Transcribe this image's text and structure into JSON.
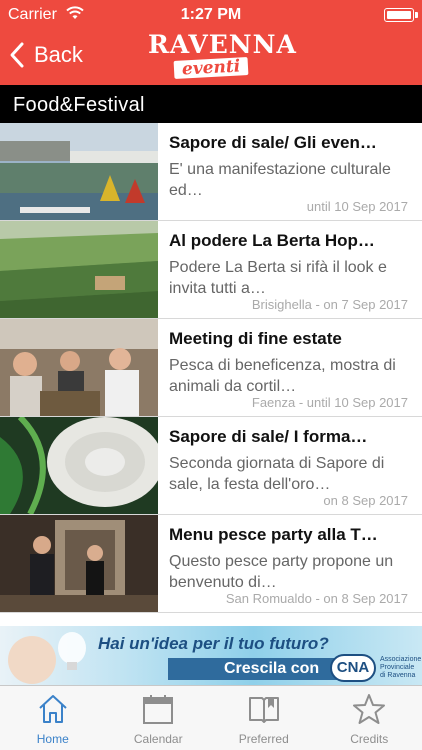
{
  "status_bar": {
    "carrier": "Carrier",
    "time": "1:27 PM"
  },
  "nav": {
    "back_label": "Back",
    "logo_line1": "RAVENNA",
    "logo_line2": "eventi"
  },
  "section_title": "Food&Festival",
  "events": [
    {
      "title": "Sapore di sale/ Gli even…",
      "description": "E' una manifestazione culturale ed…",
      "meta": "until 10 Sep 2017"
    },
    {
      "title": "Al podere La Berta Hop…",
      "description": "Podere La Berta si rifà il look e invita tutti a…",
      "meta": "Brisighella - on 7 Sep 2017"
    },
    {
      "title": "Meeting di fine estate",
      "description": "Pesca di beneficenza, mostra di animali da cortil…",
      "meta": "Faenza - until 10 Sep 2017"
    },
    {
      "title": "Sapore di sale/ I forma…",
      "description": "Seconda giornata di Sapore di sale, la festa dell'oro…",
      "meta": "on 8 Sep 2017"
    },
    {
      "title": "Menu pesce party alla T…",
      "description": "Questo pesce party propone un benvenuto di…",
      "meta": "San Romualdo - on 8 Sep 2017"
    }
  ],
  "ad": {
    "headline": "Hai un'idea per il tuo futuro?",
    "tagline": "Crescila con",
    "brand": "CNA",
    "brand_sub": "Associazione Provinciale di Ravenna"
  },
  "tabs": [
    {
      "label": "Home",
      "icon": "home-icon",
      "active": true
    },
    {
      "label": "Calendar",
      "icon": "calendar-icon",
      "active": false
    },
    {
      "label": "Preferred",
      "icon": "book-icon",
      "active": false
    },
    {
      "label": "Credits",
      "icon": "star-icon",
      "active": false
    }
  ],
  "colors": {
    "accent": "#ee4a3f",
    "tab_active": "#3b82c9",
    "tab_inactive": "#8e8e8e"
  }
}
